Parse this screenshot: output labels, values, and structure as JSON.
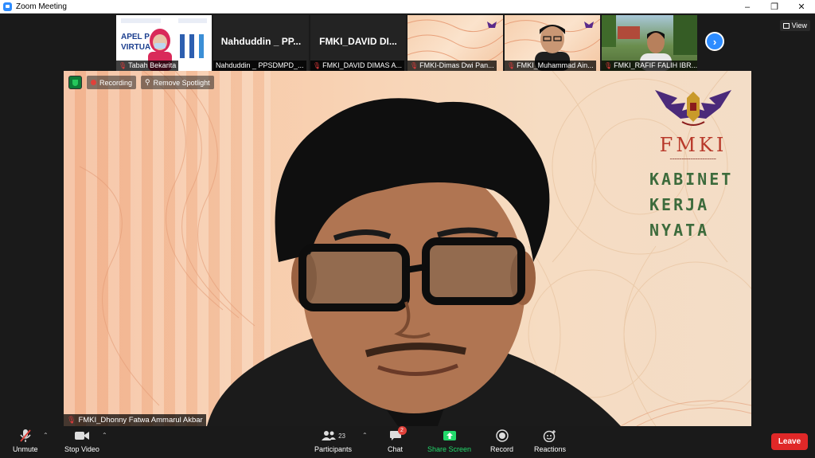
{
  "window": {
    "title": "Zoom Meeting",
    "controls": [
      "–",
      "❐",
      "✕"
    ]
  },
  "thumbnails": [
    {
      "name": "Tabah Bekarita",
      "poster_text": "APEL P VIRTUA",
      "muted": true
    },
    {
      "name": "Nahduddin _ PPSDMPD_...",
      "display_name": "Nahduddin _ PP...",
      "muted": false
    },
    {
      "name": "FMKI_DAVID DIMAS A...",
      "display_name": "FMKI_DAVID DI...",
      "muted": true
    },
    {
      "name": "FMKI-Dimas Dwi Pan...",
      "muted": true
    },
    {
      "name": "FMKI_Muhammad Ain...",
      "muted": true
    },
    {
      "name": "FMKI_RAFIF FALIH IBR...",
      "muted": true
    }
  ],
  "view_button": "View",
  "spotlight": {
    "recording_label": "Recording",
    "remove_spotlight_label": "Remove Spotlight",
    "participant_name": "FMKI_Dhonny Fatwa Ammarul Akbar",
    "logo_letters": "FMKI",
    "cabinet_lines": [
      "KABINET",
      "KERJA",
      "NYATA"
    ]
  },
  "toolbar": {
    "unmute": "Unmute",
    "stop_video": "Stop Video",
    "participants": "Participants",
    "participants_count": "23",
    "chat": "Chat",
    "chat_badge": "2",
    "share_screen": "Share Screen",
    "record": "Record",
    "reactions": "Reactions",
    "leave": "Leave"
  },
  "colors": {
    "accent": "#2d8cff",
    "share_green": "#23d96b",
    "leave_red": "#e02828"
  }
}
